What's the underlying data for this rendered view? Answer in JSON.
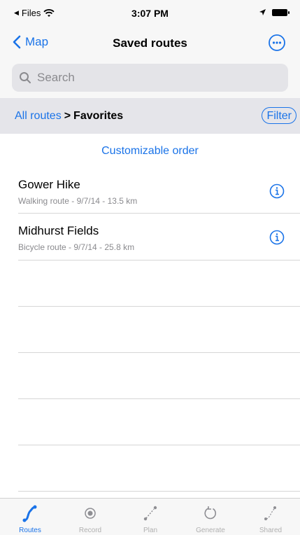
{
  "status_bar": {
    "back_app": "Files",
    "time": "3:07 PM"
  },
  "nav": {
    "back_label": "Map",
    "title": "Saved routes"
  },
  "search": {
    "placeholder": "Search"
  },
  "breadcrumb": {
    "parent": "All routes",
    "separator": ">",
    "current": "Favorites",
    "filter_label": "Filter"
  },
  "order_label": "Customizable order",
  "routes": [
    {
      "name": "Gower Hike",
      "details": "Walking route - 9/7/14 - 13.5 km"
    },
    {
      "name": "Midhurst Fields",
      "details": "Bicycle route - 9/7/14 - 25.8 km"
    }
  ],
  "tabs": [
    {
      "label": "Routes",
      "icon": "routes-icon",
      "active": true
    },
    {
      "label": "Record",
      "icon": "record-icon",
      "active": false
    },
    {
      "label": "Plan",
      "icon": "plan-icon",
      "active": false
    },
    {
      "label": "Generate",
      "icon": "generate-icon",
      "active": false
    },
    {
      "label": "Shared",
      "icon": "shared-icon",
      "active": false
    }
  ],
  "colors": {
    "accent": "#1a73e8",
    "bar_background": "#f7f7f7",
    "breadcrumb_background": "#e5e5ea"
  }
}
